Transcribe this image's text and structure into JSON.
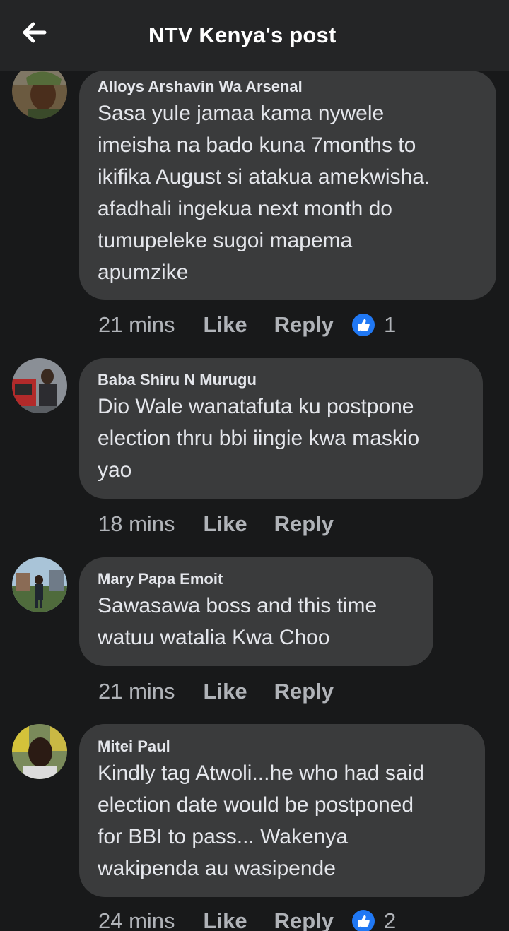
{
  "header": {
    "title": "NTV Kenya's post",
    "back_icon": "arrow-left-icon"
  },
  "colors": {
    "background": "#18191a",
    "bubble": "#3a3b3c",
    "header": "#242526",
    "like_blue": "#2078f4",
    "muted_text": "#b0b3b8"
  },
  "comments": [
    {
      "author": "Alloys Arshavin Wa Arsenal",
      "text": "Sasa yule jamaa kama nywele\nimeisha na bado kuna 7months to\nikifika August si atakua amekwisha.\nafadhali ingekua next month do\ntumupeleke sugoi mapema\napumzike",
      "time": "21 mins",
      "like_label": "Like",
      "reply_label": "Reply",
      "reaction_count": "1"
    },
    {
      "author": "Baba Shiru N Murugu",
      "text": "Dio Wale wanatafuta ku postpone\nelection thru bbi iingie kwa maskio\nyao",
      "time": "18 mins",
      "like_label": "Like",
      "reply_label": "Reply"
    },
    {
      "author": "Mary Papa Emoit",
      "text": "Sawasawa boss and this time\nwatuu watalia Kwa Choo",
      "time": "21 mins",
      "like_label": "Like",
      "reply_label": "Reply"
    },
    {
      "author": "Mitei Paul",
      "text": "Kindly tag Atwoli...he who had said\nelection date would be postponed\nfor BBI to pass... Wakenya\nwakipenda au wasipende",
      "time": "24 mins",
      "like_label": "Like",
      "reply_label": "Reply",
      "reaction_count": "2"
    }
  ]
}
